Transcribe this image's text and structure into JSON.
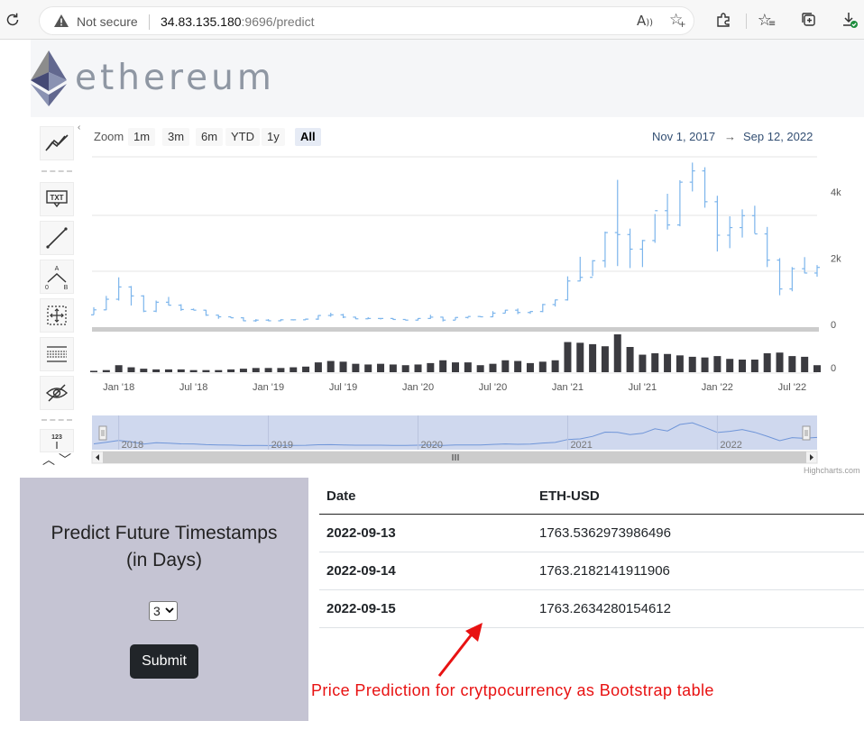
{
  "browser": {
    "security_label": "Not secure",
    "url_host": "34.83.135.180",
    "url_path": ":9696/predict"
  },
  "header": {
    "brand": "ethereum"
  },
  "chart_controls": {
    "zoom_label": "Zoom",
    "zoom_buttons": [
      "1m",
      "3m",
      "6m",
      "YTD",
      "1y",
      "All"
    ],
    "active_zoom": "All",
    "range_from": "Nov 1, 2017",
    "range_arrow": "→",
    "range_to": "Sep 12, 2022",
    "tools": [
      "trend-line-icon",
      "text-annotation-icon",
      "line-icon",
      "fibonacci-icon",
      "measure-icon",
      "indicator-icon",
      "hide-icon",
      "number-icon"
    ],
    "tool_text": {
      "txt": "TXT",
      "num": "123",
      "fib_a": "A",
      "fib_0": "0",
      "fib_b": "B"
    },
    "credits": "Highcharts.com"
  },
  "chart_data": {
    "type": "ohlc",
    "title": "",
    "x": [
      "Nov 2017",
      "Dec 2017",
      "Jan 2018",
      "Feb 2018",
      "Mar 2018",
      "Apr 2018",
      "May 2018",
      "Jun 2018",
      "Jul 2018",
      "Aug 2018",
      "Sep 2018",
      "Oct 2018",
      "Nov 2018",
      "Dec 2018",
      "Jan 2019",
      "Feb 2019",
      "Mar 2019",
      "Apr 2019",
      "May 2019",
      "Jun 2019",
      "Jul 2019",
      "Aug 2019",
      "Sep 2019",
      "Oct 2019",
      "Nov 2019",
      "Dec 2019",
      "Jan 2020",
      "Feb 2020",
      "Mar 2020",
      "Apr 2020",
      "May 2020",
      "Jun 2020",
      "Jul 2020",
      "Aug 2020",
      "Sep 2020",
      "Oct 2020",
      "Nov 2020",
      "Dec 2020",
      "Jan 2021",
      "Feb 2021",
      "Mar 2021",
      "Apr 2021",
      "May 2021",
      "Jun 2021",
      "Jul 2021",
      "Aug 2021",
      "Sep 2021",
      "Oct 2021",
      "Nov 2021",
      "Dec 2021",
      "Jan 2022",
      "Feb 2022",
      "Mar 2022",
      "Apr 2022",
      "May 2022",
      "Jun 2022",
      "Jul 2022",
      "Aug 2022",
      "Sep 2022"
    ],
    "series": [
      {
        "name": "ETH-USD",
        "open": [
          290,
          440,
          760,
          1130,
          860,
          400,
          670,
          580,
          450,
          430,
          280,
          230,
          200,
          110,
          130,
          110,
          140,
          140,
          160,
          270,
          290,
          220,
          170,
          180,
          180,
          150,
          130,
          180,
          220,
          130,
          210,
          240,
          230,
          340,
          430,
          360,
          390,
          600,
          740,
          1310,
          1420,
          1920,
          2770,
          2710,
          2270,
          2530,
          3430,
          3000,
          4290,
          4630,
          3700,
          2690,
          2920,
          3280,
          2730,
          1940,
          1070,
          1680,
          1550
        ],
        "high": [
          520,
          860,
          1420,
          1160,
          880,
          720,
          830,
          610,
          480,
          440,
          290,
          230,
          220,
          160,
          160,
          160,
          150,
          180,
          280,
          350,
          320,
          230,
          220,
          190,
          190,
          150,
          190,
          290,
          230,
          220,
          230,
          250,
          400,
          440,
          480,
          400,
          620,
          750,
          1450,
          2040,
          1940,
          2800,
          4360,
          2890,
          2550,
          3330,
          3940,
          4350,
          4880,
          4740,
          3880,
          3260,
          3470,
          3580,
          2940,
          2000,
          1730,
          2030,
          1790
        ],
        "low": [
          290,
          430,
          720,
          570,
          370,
          370,
          570,
          410,
          430,
          260,
          170,
          190,
          100,
          80,
          100,
          100,
          120,
          140,
          140,
          230,
          190,
          160,
          160,
          150,
          140,
          120,
          120,
          170,
          90,
          130,
          180,
          220,
          220,
          340,
          310,
          320,
          370,
          540,
          720,
          1300,
          1460,
          1720,
          1760,
          1700,
          1730,
          2460,
          2860,
          2960,
          4010,
          3520,
          2200,
          2300,
          2620,
          2740,
          1730,
          880,
          1000,
          1540,
          1440
        ],
        "close": [
          440,
          760,
          1130,
          860,
          400,
          670,
          580,
          450,
          430,
          280,
          230,
          200,
          110,
          130,
          110,
          140,
          140,
          160,
          270,
          290,
          220,
          170,
          180,
          180,
          150,
          130,
          180,
          220,
          130,
          210,
          240,
          230,
          340,
          430,
          360,
          390,
          600,
          740,
          1310,
          1420,
          1920,
          2770,
          2710,
          2270,
          2530,
          3430,
          3000,
          4290,
          4630,
          3700,
          2690,
          2920,
          3280,
          2730,
          1940,
          1070,
          1680,
          1550,
          1720
        ]
      },
      {
        "name": "Volume",
        "values": [
          2,
          3,
          10,
          7,
          5,
          4,
          4,
          4,
          3,
          3,
          3,
          4,
          5,
          6,
          6,
          6,
          7,
          8,
          14,
          16,
          15,
          12,
          11,
          12,
          11,
          10,
          11,
          13,
          17,
          14,
          14,
          10,
          12,
          17,
          16,
          13,
          15,
          17,
          43,
          42,
          40,
          37,
          54,
          36,
          25,
          27,
          26,
          24,
          22,
          21,
          23,
          19,
          18,
          18,
          27,
          28,
          23,
          22,
          10
        ]
      }
    ],
    "ylabels_price": [
      "4k",
      "2k",
      "0"
    ],
    "ylabel_volume": "0",
    "xlabels": [
      "Jan '18",
      "Jul '18",
      "Jan '19",
      "Jul '19",
      "Jan '20",
      "Jul '20",
      "Jan '21",
      "Jul '21",
      "Jan '22",
      "Jul '22"
    ],
    "navigator_labels": [
      "2018",
      "2019",
      "2020",
      "2021",
      "2022"
    ],
    "ylim": [
      0,
      5000
    ]
  },
  "predict_form": {
    "title_line1": "Predict Future Timestamps",
    "title_line2": "(in Days)",
    "days_value": "3",
    "submit_label": "Submit"
  },
  "prediction_table": {
    "headers": [
      "Date",
      "ETH-USD"
    ],
    "rows": [
      [
        "2022-09-13",
        "1763.5362973986496"
      ],
      [
        "2022-09-14",
        "1763.2182141911906"
      ],
      [
        "2022-09-15",
        "1763.2634280154612"
      ]
    ]
  },
  "annotation": {
    "caption": "Price Prediction for crytpocurrency as Bootstrap table"
  },
  "colors": {
    "ohlc": "#7cb5ec",
    "volume": "#3b3b40",
    "navigator": "#cfd8ee",
    "panel": "#c5c4d3",
    "button": "#212529",
    "caption": "#e81212"
  }
}
